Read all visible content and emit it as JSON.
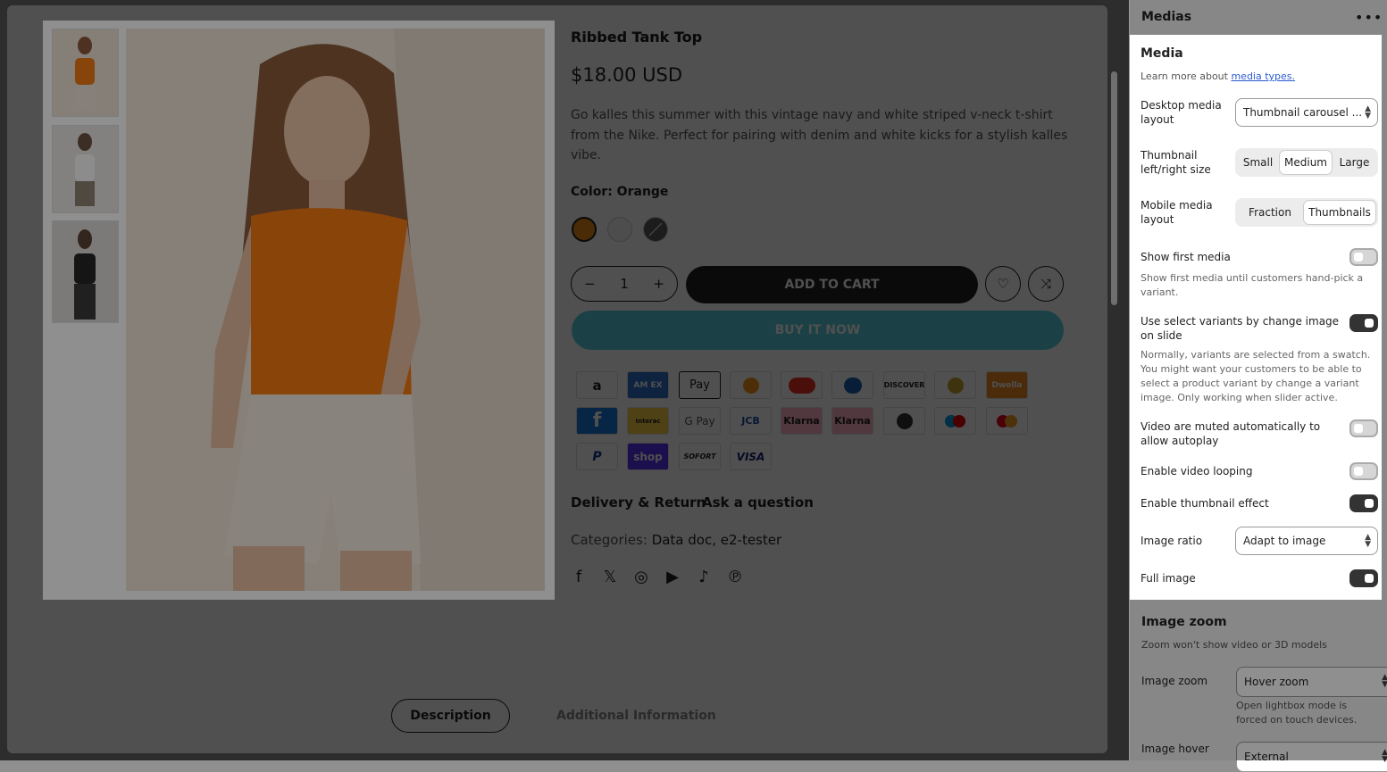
{
  "product": {
    "title": "Ribbed Tank Top",
    "price": "$18.00 USD",
    "description": "Go kalles this summer with this vintage navy and white striped v-neck t-shirt from the Nike. Perfect for pairing with denim and white kicks for a stylish kalles vibe.",
    "color_label": "Color: Orange",
    "swatches": [
      {
        "name": "orange",
        "color": "#e8891a",
        "selected": true
      },
      {
        "name": "white",
        "color": "#f4f4f4",
        "selected": false
      },
      {
        "name": "black",
        "color": "#5a5a5a",
        "selected": false
      }
    ],
    "quantity": "1",
    "qty_minus": "−",
    "qty_plus": "+",
    "add_to_cart": "ADD TO CART",
    "buy_now": "BUY IT NOW",
    "wishlist_icon": "heart-icon",
    "compare_icon": "shuffle-icon",
    "payment_methods": [
      "amazon",
      "amex",
      "apple-pay",
      "bitcoin",
      "dankort",
      "diners",
      "discover",
      "dogecoin",
      "dwolla",
      "forbrugsforeningen",
      "interac",
      "google-pay",
      "jcb",
      "klarna",
      "klarna-pay-later",
      "litecoin",
      "maestro",
      "mastercard",
      "paypal",
      "shop-pay",
      "sofort",
      "visa"
    ],
    "payment_labels": {
      "amex": "AM EX",
      "apple_pay": "Pay",
      "discover": "DISCOVER",
      "dwolla": "Dwolla",
      "google_pay": "G Pay",
      "klarna": "Klarna",
      "klarna2": "Klarna",
      "shop_pay": "shop",
      "sofort": "SOFORT",
      "visa": "VISA",
      "interac": "Interac",
      "jcb": "JCB"
    },
    "links": {
      "delivery": "Delivery & Return",
      "ask": "Ask a question"
    },
    "categories_label": "Categories:",
    "categories_value": "Data doc, e2-tester",
    "social_icons": [
      "facebook-icon",
      "x-icon",
      "instagram-icon",
      "youtube-icon",
      "tiktok-icon",
      "pinterest-icon"
    ],
    "tabs": {
      "description": "Description",
      "additional": "Additional Information"
    }
  },
  "sidebar": {
    "title": "Medias",
    "menu_icon": "more-icon",
    "panel": {
      "title": "Media",
      "learn_prefix": "Learn more about ",
      "learn_link": "media types.",
      "desktop_layout_label": "Desktop media layout",
      "desktop_layout_value": "Thumbnail carousel ...",
      "thumb_size_label": "Thumbnail left/right size",
      "thumb_size_options": [
        "Small",
        "Medium",
        "Large"
      ],
      "thumb_size_selected": "Medium",
      "mobile_layout_label": "Mobile media layout",
      "mobile_layout_options": [
        "Fraction",
        "Thumbnails"
      ],
      "mobile_layout_selected": "Thumbnails",
      "show_first_label": "Show first media",
      "show_first_on": false,
      "show_first_help": "Show first media until customers hand-pick a variant.",
      "use_select_label": "Use select variants by change image on slide",
      "use_select_on": true,
      "use_select_help": "Normally, variants are selected from a swatch. You might want your customers to be able to select a product variant by change a variant image. Only working when slider active.",
      "video_muted_label": "Video are muted automatically to allow autoplay",
      "video_muted_on": false,
      "video_loop_label": "Enable video looping",
      "video_loop_on": false,
      "thumb_effect_label": "Enable thumbnail effect",
      "thumb_effect_on": true,
      "image_ratio_label": "Image ratio",
      "image_ratio_value": "Adapt to image",
      "full_image_label": "Full image",
      "full_image_on": true
    },
    "zoom": {
      "title": "Image zoom",
      "help": "Zoom won't show video or 3D models",
      "zoom_label": "Image zoom",
      "zoom_value": "Hover zoom",
      "zoom_note": "Open lightbox mode is forced on touch devices.",
      "hover_label": "Image hover",
      "hover_value": "External"
    }
  }
}
